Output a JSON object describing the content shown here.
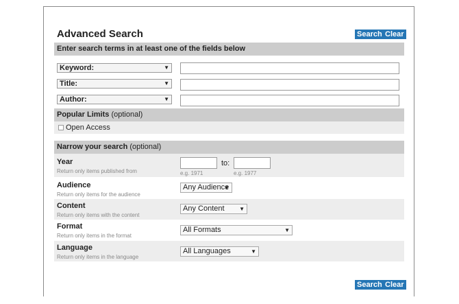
{
  "header": {
    "title": "Advanced Search",
    "search_label": "Search",
    "clear_label": "Clear"
  },
  "terms": {
    "instruction": "Enter search terms in at least one of the fields below",
    "rows": [
      {
        "field": "Keyword:",
        "value": ""
      },
      {
        "field": "Title:",
        "value": ""
      },
      {
        "field": "Author:",
        "value": ""
      }
    ]
  },
  "popular": {
    "heading": "Popular Limits",
    "note": "(optional)",
    "open_access": "Open Access"
  },
  "narrow": {
    "heading": "Narrow your search",
    "note": "(optional)",
    "year": {
      "label": "Year",
      "help": "Return only items published from",
      "to": "to:",
      "from_hint": "e.g. 1971",
      "to_hint": "e.g. 1977"
    },
    "audience": {
      "label": "Audience",
      "help": "Return only items for the audience",
      "value": "Any Audience"
    },
    "content": {
      "label": "Content",
      "help": "Return only items with the content",
      "value": "Any Content"
    },
    "format": {
      "label": "Format",
      "help": "Return only items in the format",
      "value": "All Formats"
    },
    "language": {
      "label": "Language",
      "help": "Return only items in the language",
      "value": "All Languages"
    }
  },
  "footer": {
    "search_label": "Search",
    "clear_label": "Clear"
  },
  "colors": {
    "accent": "#2576b5",
    "bar": "#cccccc",
    "shade": "#ededed"
  },
  "icons": {
    "dropdown": "dropdown-arrow-icon"
  }
}
